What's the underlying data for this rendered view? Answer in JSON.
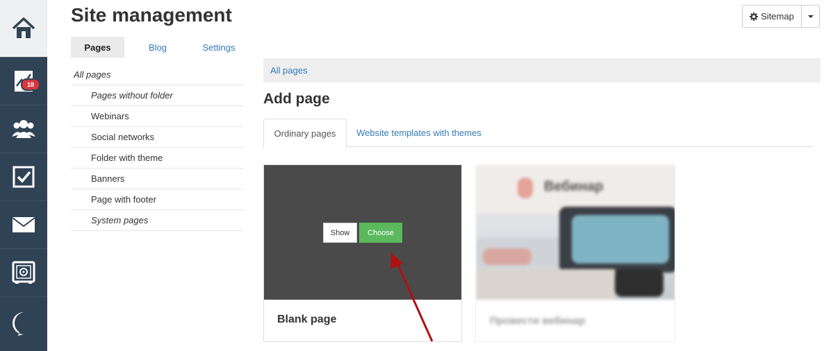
{
  "header": {
    "title": "Site management",
    "sitemap_label": "Sitemap"
  },
  "rail": {
    "items": [
      {
        "icon": "home-icon"
      },
      {
        "icon": "chart-icon",
        "badge": "18"
      },
      {
        "icon": "users-icon"
      },
      {
        "icon": "tasks-icon"
      },
      {
        "icon": "mail-icon"
      },
      {
        "icon": "safe-icon"
      },
      {
        "icon": "chat-logo-icon"
      }
    ]
  },
  "top_tabs": [
    {
      "label": "Pages",
      "active": true
    },
    {
      "label": "Blog",
      "active": false
    },
    {
      "label": "Settings",
      "active": false
    }
  ],
  "folders": {
    "root": "All pages",
    "items": [
      "Pages without folder",
      "Webinars",
      "Social networks",
      "Folder with theme",
      "Banners",
      "Page with footer",
      "System pages"
    ]
  },
  "breadcrumb": "All pages",
  "add_page_title": "Add page",
  "content_tabs": [
    {
      "label": "Ordinary pages",
      "active": true
    },
    {
      "label": "Website templates with themes",
      "active": false
    }
  ],
  "cards": [
    {
      "name": "Blank page",
      "show_label": "Show",
      "choose_label": "Choose"
    },
    {
      "name": "Провести вебинар",
      "preview_title": "Вебинар"
    }
  ],
  "colors": {
    "rail_bg": "#2f4354",
    "link": "#337ab7",
    "choose_green": "#5cb85c",
    "badge_red": "#d9363e",
    "arrow_red": "#b00f14"
  }
}
